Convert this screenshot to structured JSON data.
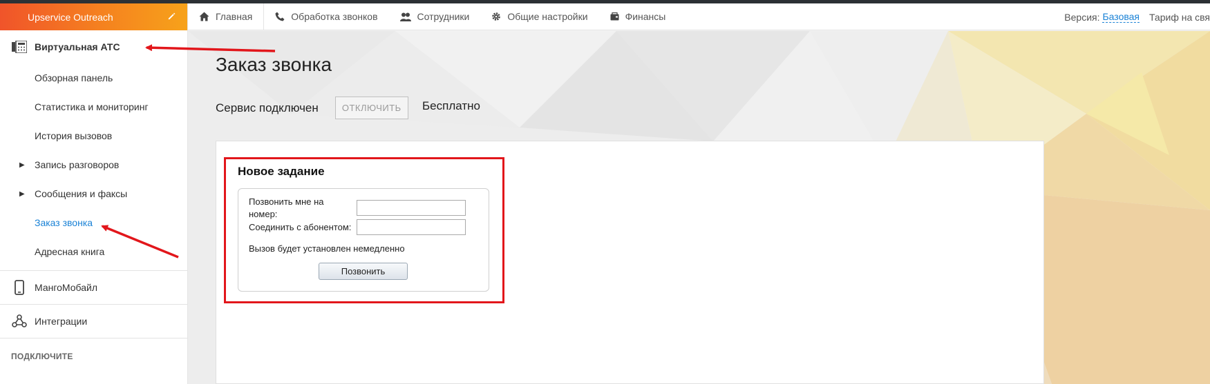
{
  "account": {
    "name": "Upservice Outreach",
    "edit_icon": "pencil-icon"
  },
  "sidebar": {
    "section_title": "Виртуальная АТС",
    "section_icon": "pbx-icon",
    "items": [
      {
        "label": "Обзорная панель",
        "expandable": false,
        "active": false
      },
      {
        "label": "Статистика и мониторинг",
        "expandable": false,
        "active": false
      },
      {
        "label": "История вызовов",
        "expandable": false,
        "active": false
      },
      {
        "label": "Запись разговоров",
        "expandable": true,
        "active": false
      },
      {
        "label": "Сообщения и факсы",
        "expandable": true,
        "active": false
      },
      {
        "label": "Заказ звонка",
        "expandable": false,
        "active": true
      },
      {
        "label": "Адресная книга",
        "expandable": false,
        "active": false
      }
    ],
    "groups": [
      {
        "label": "МангоМобайл",
        "icon": "mobile-phone-icon"
      },
      {
        "label": "Интеграции",
        "icon": "integrations-icon"
      }
    ],
    "footer_label": "ПОДКЛЮЧИТЕ"
  },
  "topnav": {
    "items": [
      {
        "label": "Главная",
        "icon": "home-icon"
      },
      {
        "label": "Обработка звонков",
        "icon": "phone-icon"
      },
      {
        "label": "Сотрудники",
        "icon": "users-icon"
      },
      {
        "label": "Общие настройки",
        "icon": "gear-icon"
      },
      {
        "label": "Финансы",
        "icon": "wallet-icon"
      }
    ],
    "version_label": "Версия:",
    "version_value": "Базовая",
    "tariff_label": "Тариф на свя"
  },
  "page": {
    "title": "Заказ звонка",
    "service_status": "Сервис подключен",
    "disable_button": "ОТКЛЮЧИТЬ",
    "price": "Бесплатно"
  },
  "task": {
    "title": "Новое задание",
    "call_me_label": "Позвонить мне на номер:",
    "call_me_value": "",
    "connect_label": "Соединить с абонентом:",
    "connect_value": "",
    "note": "Вызов будет установлен немедленно",
    "call_button": "Позвонить"
  },
  "colors": {
    "accent_blue": "#1a82d6",
    "highlight_red": "#e2161b",
    "account_orange": "#f5821f"
  }
}
